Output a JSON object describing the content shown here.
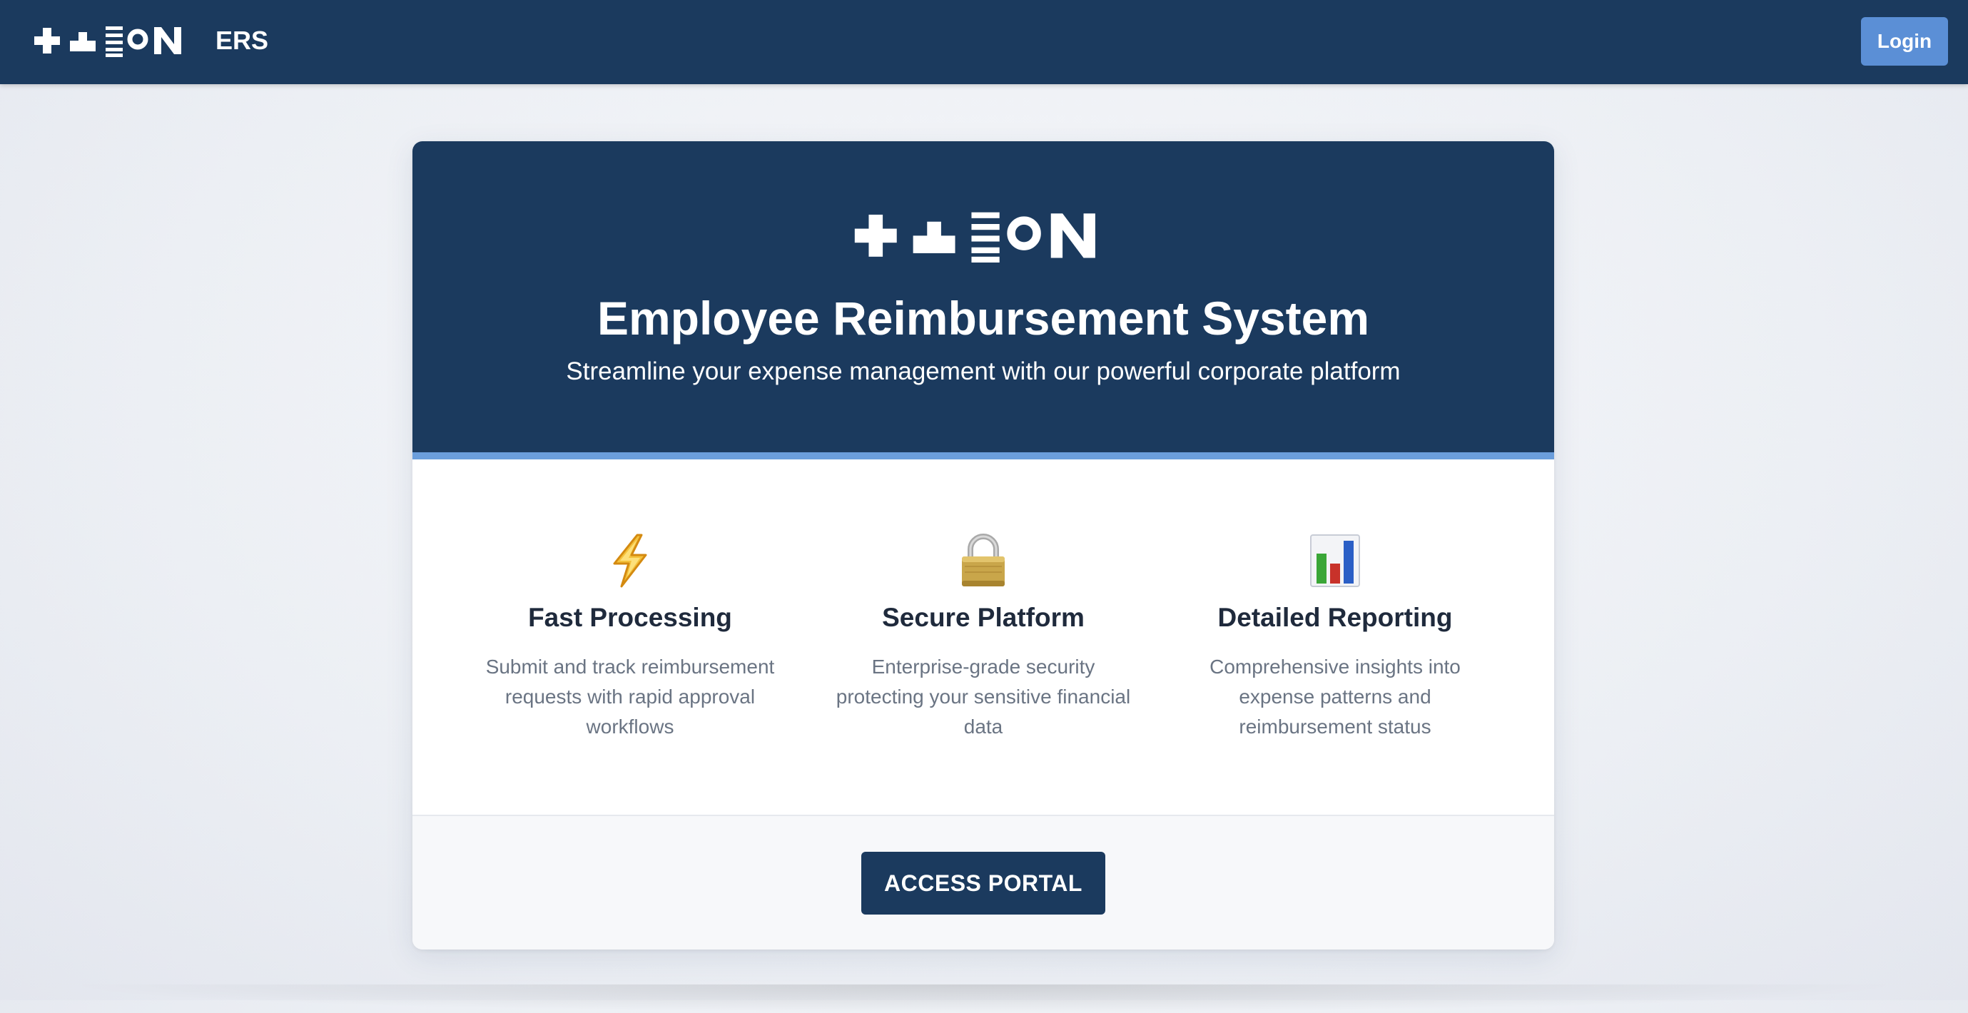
{
  "navbar": {
    "logo_name": "tekion-logo",
    "app_name": "ERS",
    "login_label": "Login"
  },
  "hero": {
    "logo_name": "tekion-logo",
    "title": "Employee Reimbursement System",
    "subtitle": "Streamline your expense management with our powerful corporate platform"
  },
  "features": [
    {
      "icon": "lightning-icon",
      "title": "Fast Processing",
      "description": "Submit and track reimbursement requests with rapid approval workflows"
    },
    {
      "icon": "padlock-icon",
      "title": "Secure Platform",
      "description": "Enterprise-grade security protecting your sensitive financial data"
    },
    {
      "icon": "bar-chart-icon",
      "title": "Detailed Reporting",
      "description": "Comprehensive insights into expense patterns and reimbursement status"
    }
  ],
  "cta": {
    "label": "ACCESS PORTAL"
  },
  "colors": {
    "navy": "#1b3a5e",
    "accent_blue": "#5b8fd6",
    "stripe_blue": "#6b9edc",
    "text_dark": "#1f2a3c",
    "text_muted": "#6a7483"
  }
}
